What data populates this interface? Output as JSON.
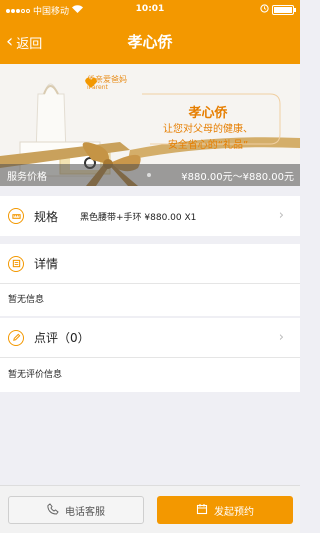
{
  "status_bar": {
    "carrier": "中国移动",
    "time": "10:01"
  },
  "nav": {
    "back_label": "返回",
    "title": "孝心侨"
  },
  "banner": {
    "brand_name": "侨亲爱爸妈",
    "brand_sub": "iParent",
    "headline": "孝心侨",
    "line1": "让您对父母的健康、",
    "line2": "安全省心的“礼品”"
  },
  "price_bar": {
    "label": "服务价格",
    "value": "¥880.00元～¥880.00元"
  },
  "spec": {
    "label": "规格",
    "value": "黑色腰带+手环 ¥880.00 X1"
  },
  "details": {
    "label": "详情",
    "empty_text": "暂无信息"
  },
  "reviews": {
    "label": "点评（0）",
    "empty_text": "暂无评价信息"
  },
  "bottom": {
    "call_label": "电话客服",
    "book_label": "发起预约"
  },
  "colors": {
    "accent": "#f39800",
    "background": "#efeff4"
  }
}
